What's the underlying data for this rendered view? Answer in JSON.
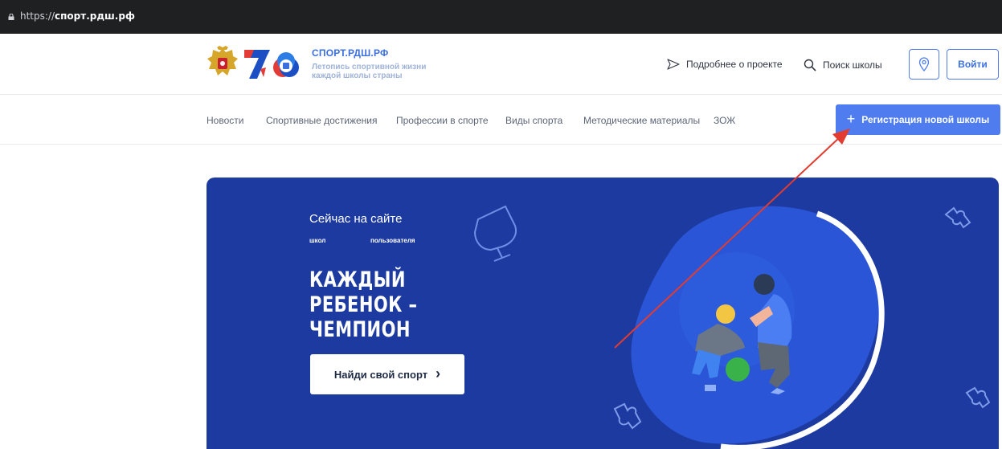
{
  "browser": {
    "url_scheme": "https://",
    "url_host": "спорт.рдш.рф"
  },
  "header": {
    "brand_name": "СПОРТ.РДШ.РФ",
    "brand_tagline": "Летопись спортивной жизни каждой школы страны",
    "about_link": "Подробнее о проекте",
    "search_link": "Поиск школы",
    "login_button": "Войти"
  },
  "nav": {
    "items": [
      "Новости",
      "Спортивные достижения",
      "Профессии в спорте",
      "Виды спорта",
      "Методические материалы",
      "ЗОЖ"
    ],
    "register_button": "Регистрация новой школы"
  },
  "hero": {
    "kicker": "Сейчас на сайте",
    "stat_schools": "школ",
    "stat_users": "пользователя",
    "title_line1": "КАЖДЫЙ РЕБЕНОК –",
    "title_line2": "ЧЕМПИОН",
    "cta_button": "Найди свой спорт",
    "cta_chevron": "›"
  },
  "colors": {
    "accent": "#4f7df0",
    "hero_bg": "#1c3aa0",
    "annotation": "#e23b2f"
  },
  "icons": [
    "lock-icon",
    "send-icon",
    "search-icon",
    "map-pin-icon",
    "plus-icon",
    "trophy-icon",
    "puzzle-icon",
    "chevron-right-icon"
  ]
}
